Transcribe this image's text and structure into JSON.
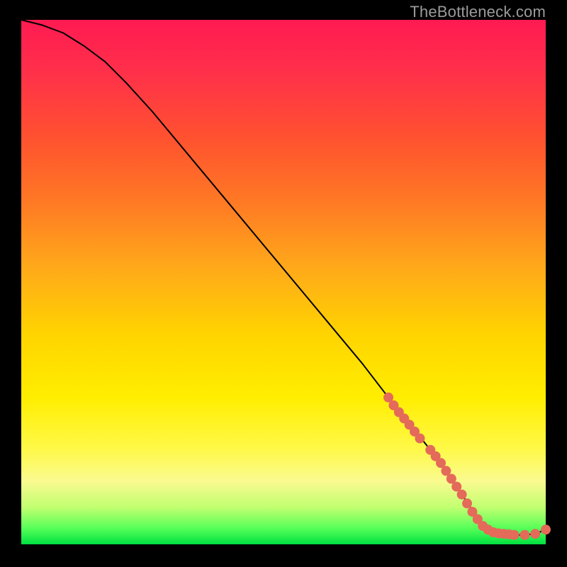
{
  "watermark": "TheBottleneck.com",
  "chart_data": {
    "type": "line",
    "title": "",
    "xlabel": "",
    "ylabel": "",
    "xlim": [
      0,
      100
    ],
    "ylim": [
      0,
      100
    ],
    "grid": false,
    "series": [
      {
        "name": "curve",
        "stroke": "#000000",
        "x": [
          0,
          4,
          8,
          12,
          16,
          20,
          25,
          30,
          35,
          40,
          45,
          50,
          55,
          60,
          65,
          70,
          74,
          78,
          82,
          84,
          86,
          88,
          90,
          92,
          94,
          96,
          98,
          100
        ],
        "y": [
          100,
          99,
          97.5,
          95,
          92,
          88,
          82.5,
          76.5,
          70.5,
          64.5,
          58.5,
          52.5,
          46.5,
          40.5,
          34.5,
          28,
          23,
          18,
          12.5,
          9.5,
          6.5,
          4,
          2.5,
          2,
          1.8,
          1.8,
          2,
          2.8
        ]
      },
      {
        "name": "markers",
        "marker_color": "#e46a5a",
        "points": [
          {
            "x": 70,
            "y": 28
          },
          {
            "x": 71,
            "y": 26.5
          },
          {
            "x": 72,
            "y": 25.2
          },
          {
            "x": 73,
            "y": 24
          },
          {
            "x": 74,
            "y": 22.8
          },
          {
            "x": 75,
            "y": 21.5
          },
          {
            "x": 76,
            "y": 20.2
          },
          {
            "x": 78,
            "y": 18
          },
          {
            "x": 79,
            "y": 16.8
          },
          {
            "x": 80,
            "y": 15.5
          },
          {
            "x": 81,
            "y": 14
          },
          {
            "x": 82,
            "y": 12.5
          },
          {
            "x": 83,
            "y": 11
          },
          {
            "x": 84,
            "y": 9.5
          },
          {
            "x": 85,
            "y": 7.8
          },
          {
            "x": 86,
            "y": 6.2
          },
          {
            "x": 87,
            "y": 4.8
          },
          {
            "x": 88,
            "y": 3.5
          },
          {
            "x": 89,
            "y": 2.8
          },
          {
            "x": 90,
            "y": 2.3
          },
          {
            "x": 91,
            "y": 2.1
          },
          {
            "x": 92,
            "y": 2.0
          },
          {
            "x": 93,
            "y": 1.9
          },
          {
            "x": 94,
            "y": 1.8
          },
          {
            "x": 96,
            "y": 1.8
          },
          {
            "x": 98,
            "y": 2.0
          },
          {
            "x": 100,
            "y": 2.8
          }
        ]
      }
    ]
  }
}
